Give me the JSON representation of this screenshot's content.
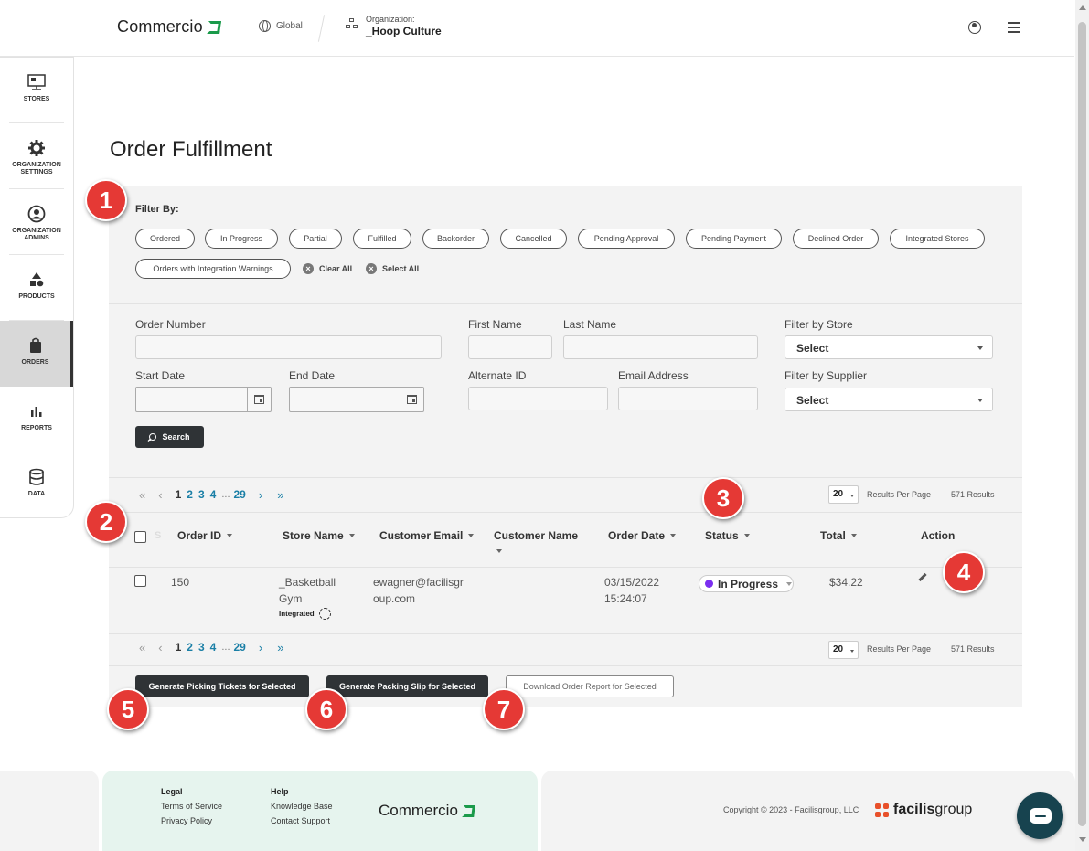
{
  "header": {
    "brand": "Commercio",
    "global_label": "Global",
    "org_label": "Organization:",
    "org_name": "_Hoop Culture",
    "icons": [
      "globe-icon",
      "org-chart-icon",
      "user-circle-icon",
      "hamburger-menu-icon"
    ]
  },
  "sidebar": {
    "items": [
      {
        "label": "STORES",
        "icon": "store-monitor-icon"
      },
      {
        "label": "ORGANIZATION SETTINGS",
        "icon": "gear-icon"
      },
      {
        "label": "ORGANIZATION ADMINS",
        "icon": "user-circle-icon"
      },
      {
        "label": "PRODUCTS",
        "icon": "shapes-icon"
      },
      {
        "label": "ORDERS",
        "icon": "shopping-bag-icon",
        "active": true
      },
      {
        "label": "REPORTS",
        "icon": "bar-chart-icon"
      },
      {
        "label": "DATA",
        "icon": "database-icon"
      }
    ]
  },
  "main": {
    "title": "Order Fulfillment",
    "filter_by_label": "Filter By:",
    "chips": [
      "Ordered",
      "In Progress",
      "Partial",
      "Fulfilled",
      "Backorder",
      "Cancelled",
      "Pending Approval",
      "Pending Payment",
      "Declined Order",
      "Integrated Stores",
      "Orders with Integration Warnings"
    ],
    "clear_all": "Clear All",
    "select_all": "Select All",
    "fields": {
      "order_number": "Order Number",
      "first_name": "First Name",
      "last_name": "Last Name",
      "filter_store": "Filter by Store",
      "start_date": "Start Date",
      "end_date": "End Date",
      "alternate_id": "Alternate ID",
      "email": "Email Address",
      "filter_supplier": "Filter by Supplier",
      "select_placeholder": "Select"
    },
    "search_label": "Search",
    "pagination": {
      "pages": [
        "1",
        "2",
        "3",
        "4"
      ],
      "ellipsis": "...",
      "last_page": "29",
      "per_page": "20",
      "per_page_label": "Results Per Page",
      "results": "571 Results"
    },
    "table": {
      "columns": [
        "Order ID",
        "Store Name",
        "Customer Email",
        "Customer Name",
        "Order Date",
        "Status",
        "Total",
        "Action"
      ],
      "hidden_col_letter": "S",
      "rows": [
        {
          "order_id": "150",
          "store_line1": "_Basketball",
          "store_line2": "Gym",
          "integrated_label": "Integrated",
          "email_line1": "ewagner@facilisgr",
          "email_line2": "oup.com",
          "customer_name": "",
          "date_line1": "03/15/2022",
          "date_line2": "15:24:07",
          "status": "In Progress",
          "status_color": "#7b2ff0",
          "total": "$34.22"
        }
      ]
    },
    "actions": {
      "picking": "Generate Picking Tickets for Selected",
      "packing": "Generate Packing Slip for Selected",
      "report": "Download Order Report for Selected"
    },
    "badges": [
      "1",
      "2",
      "3",
      "4",
      "5",
      "6",
      "7"
    ]
  },
  "footer": {
    "legal_heading": "Legal",
    "terms": "Terms of Service",
    "privacy": "Privacy Policy",
    "help_heading": "Help",
    "kb": "Knowledge Base",
    "contact": "Contact Support",
    "brand": "Commercio",
    "copyright": "Copyright © 2023 - Facilisgroup, LLC",
    "facilis_bold": "facilis",
    "facilis_rest": "group"
  },
  "colors": {
    "accent_green": "#1a9a4a",
    "dark_button": "#2f3336",
    "link_blue": "#1a7fa6",
    "badge_red": "#e53935",
    "chat": "#17434f"
  }
}
